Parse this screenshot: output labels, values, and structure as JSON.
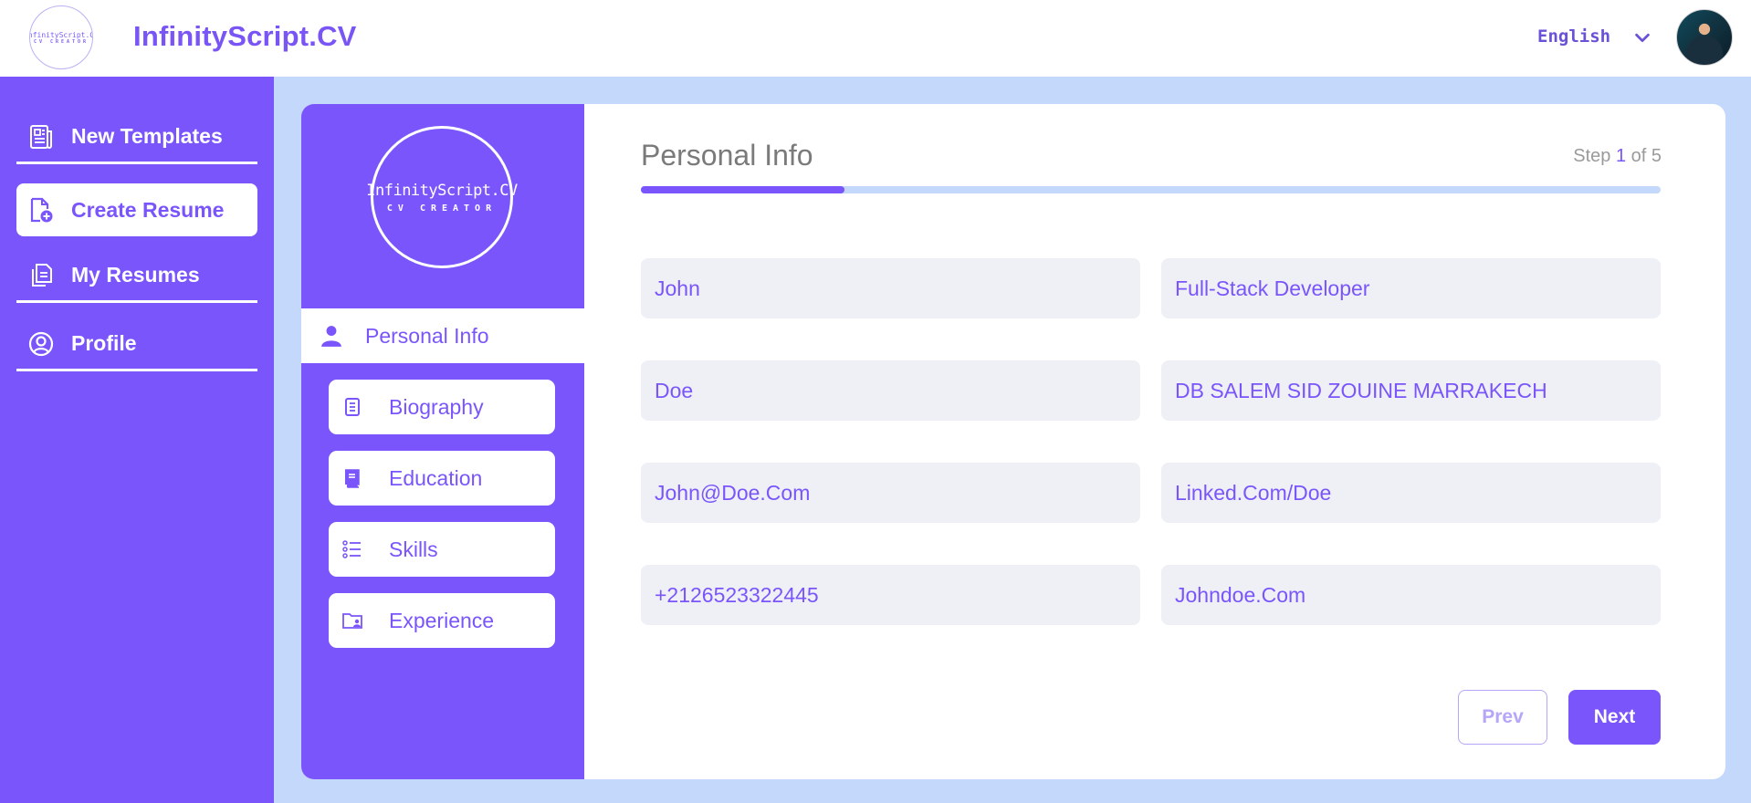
{
  "header": {
    "logo": {
      "line1": "InfinityScript.CV",
      "line2": "CV CREATOR"
    },
    "brand": "InfinityScript.CV",
    "language": {
      "selected": "English",
      "icon": "chevron-down-icon"
    },
    "avatar": "user-avatar"
  },
  "sidebar": {
    "items": [
      {
        "label": "New Templates",
        "icon": "newspaper-icon",
        "active": false
      },
      {
        "label": "Create Resume",
        "icon": "file-plus-icon",
        "active": true
      },
      {
        "label": "My Resumes",
        "icon": "copy-icon",
        "active": false
      },
      {
        "label": "Profile",
        "icon": "user-circle-icon",
        "active": false
      }
    ]
  },
  "steps_panel": {
    "logo": {
      "line1": "InfinityScript.CV",
      "line2": "CV CREATOR"
    },
    "active_step": {
      "label": "Personal Info",
      "icon": "user-icon"
    },
    "steps": [
      {
        "label": "Biography",
        "icon": "document-icon"
      },
      {
        "label": "Education",
        "icon": "book-icon"
      },
      {
        "label": "Skills",
        "icon": "list-icon"
      },
      {
        "label": "Experience",
        "icon": "folder-user-icon"
      }
    ]
  },
  "form": {
    "title": "Personal Info",
    "step": {
      "prefix": "Step",
      "current": "1",
      "of_text": "of 5"
    },
    "progress_fraction": 0.2,
    "fields": {
      "first_name": "John",
      "job_title": "Full-Stack Developer",
      "last_name": "Doe",
      "address": "DB SALEM SID ZOUINE MARRAKECH",
      "email": "John@Doe.Com",
      "linkedin": "Linked.Com/Doe",
      "phone": "+2126523322445",
      "website": "Johndoe.Com"
    },
    "buttons": {
      "prev": "Prev",
      "next": "Next"
    }
  },
  "colors": {
    "accent": "#7a55fb",
    "background": "#c3d8fb",
    "input_bg": "#eef0f6"
  }
}
